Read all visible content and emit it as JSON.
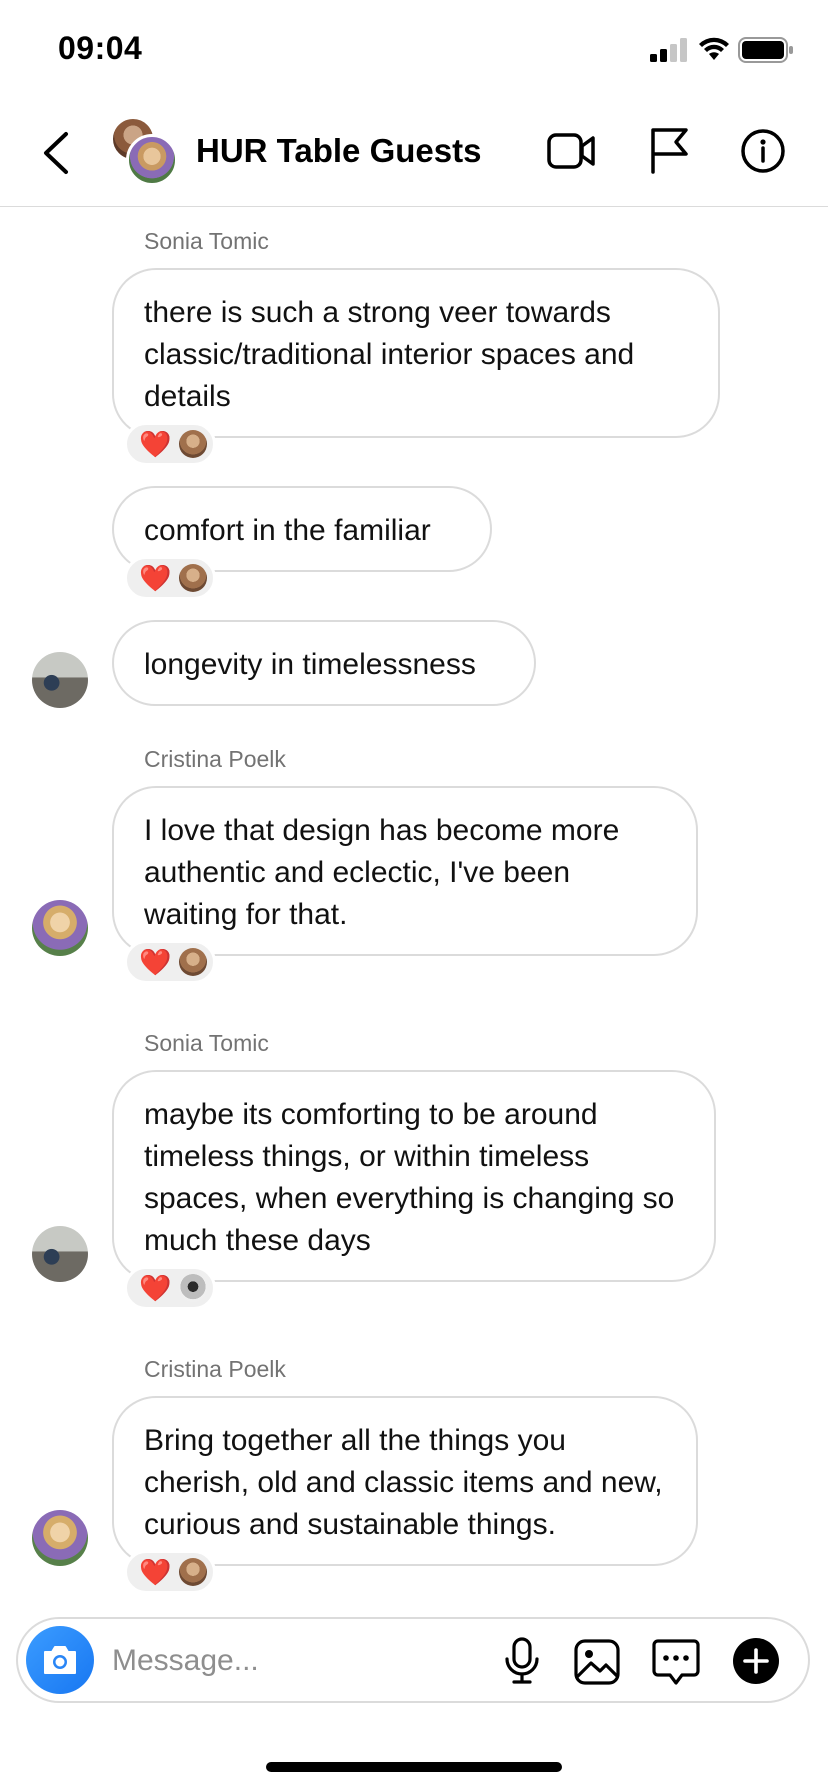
{
  "status_bar": {
    "time": "09:04"
  },
  "header": {
    "title": "HUR Table Guests"
  },
  "messages": [
    {
      "sender": "Sonia Tomic",
      "text": "there is such a strong veer towards classic/traditional interior spaces and details",
      "reaction": "❤️"
    },
    {
      "text": "comfort in the familiar",
      "reaction": "❤️"
    },
    {
      "text": "longevity in timelessness"
    },
    {
      "sender": "Cristina Poelk",
      "text": "I love that design has become more authentic and eclectic, I've been waiting for that.",
      "reaction": "❤️"
    },
    {
      "sender": "Sonia Tomic",
      "text": "maybe its comforting to be around timeless things, or within timeless spaces, when everything is changing so much these days",
      "reaction": "❤️"
    },
    {
      "sender": "Cristina Poelk",
      "text": "Bring together all the things you cherish, old and classic items and new, curious and sustainable things.",
      "reaction": "❤️"
    }
  ],
  "composer": {
    "placeholder": "Message..."
  },
  "icons": {
    "back": "chevron-left-icon",
    "video": "video-camera-icon",
    "flag": "flag-icon",
    "info": "info-icon",
    "camera": "camera-icon",
    "mic": "microphone-icon",
    "gallery": "image-icon",
    "sticker": "chat-sticker-icon",
    "plus": "plus-circle-icon"
  },
  "colors": {
    "accent": "#1877f2",
    "heart": "#ed1c3a",
    "bubble_border": "#dbdbdb",
    "secondary_text": "#737373"
  }
}
